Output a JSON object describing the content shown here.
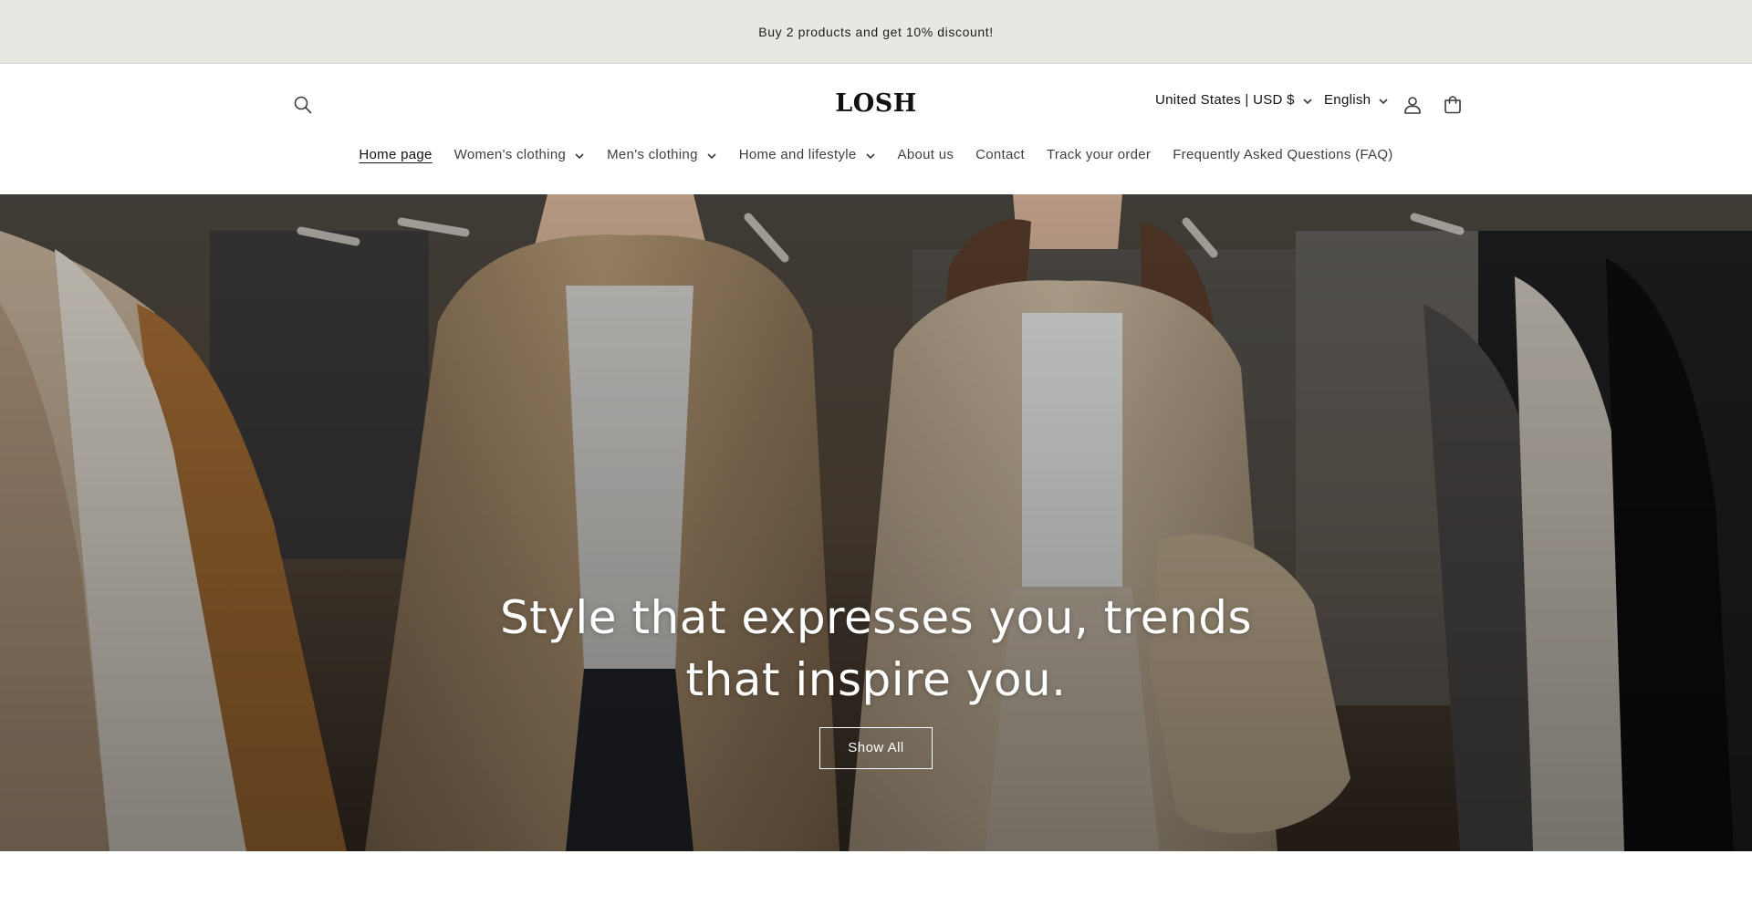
{
  "announcement": {
    "text": "Buy 2 products and get 10% discount!"
  },
  "header": {
    "logo": "LOSH",
    "country": "United States | USD $",
    "language": "English",
    "icons": {
      "search": "search-icon",
      "account": "account-icon",
      "cart": "cart-icon"
    }
  },
  "nav": {
    "items": [
      {
        "label": "Home page",
        "active": true,
        "dropdown": false
      },
      {
        "label": "Women's clothing",
        "dropdown": true
      },
      {
        "label": "Men's clothing",
        "dropdown": true
      },
      {
        "label": "Home and lifestyle",
        "dropdown": true
      },
      {
        "label": "About us",
        "dropdown": false
      },
      {
        "label": "Contact",
        "dropdown": false
      },
      {
        "label": "Track your order",
        "dropdown": false
      },
      {
        "label": "Frequently Asked Questions (FAQ)",
        "dropdown": false
      }
    ]
  },
  "hero": {
    "title": "Style that expresses you, trends that inspire you.",
    "button_label": "Show All"
  },
  "colors": {
    "announcement_bg": "#e8e8e2",
    "text": "#121212",
    "hero_text": "#ffffff"
  }
}
